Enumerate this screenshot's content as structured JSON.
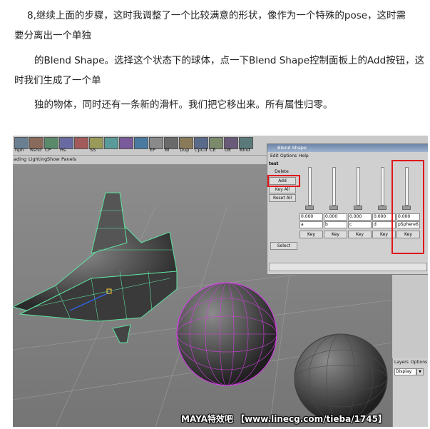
{
  "article": {
    "lines": [
      "8,继续上面的步骤，这时我调整了一个比较满意的形状，像作为一个特殊的pose，这时需",
      "要分离出一个单独",
      "的Blend Shape。选择这个状态下的球体，点一下Blend Shape控制面板上的Add按钮，这",
      "时我们生成了一个单",
      "独的物体，同时还有一条新的滑杆。我们把它移出来。所有属性归零。"
    ]
  },
  "maya": {
    "shelf": [
      "hph",
      "Rshd",
      "CP",
      "Hs",
      "",
      "SS",
      "",
      "",
      "",
      "EP",
      "Bl",
      "Dup",
      "CpCd",
      "CE",
      "GE",
      "Blnd"
    ],
    "view_menu": [
      "ading",
      "Lighting",
      "Show",
      "Panels"
    ],
    "blend_shape": {
      "title": "Blend Shape",
      "menu": [
        "Edit",
        "Options",
        "Help"
      ],
      "node": "test",
      "buttons": {
        "delete": "Delete",
        "add": "Add",
        "key_all": "Key All",
        "reset_all": "Reset All",
        "select": "Select"
      },
      "sliders": [
        {
          "value": "0.000",
          "name": "a",
          "key": "Key"
        },
        {
          "value": "0.000",
          "name": "b",
          "key": "Key"
        },
        {
          "value": "0.000",
          "name": "c",
          "key": "Key"
        },
        {
          "value": "0.000",
          "name": "d",
          "key": "Key"
        },
        {
          "value": "0.000",
          "name": "pSphere6",
          "key": "Key"
        }
      ]
    },
    "layers": {
      "tabs": [
        "Layers",
        "Options"
      ],
      "display": "Display"
    }
  },
  "watermark": "MAYA特效吧 【www.linecg.com/tieba/1745】",
  "colors": {
    "highlight": "#e0161a",
    "wire_green": "#5fe0a0",
    "wire_magenta": "#d040e0"
  }
}
